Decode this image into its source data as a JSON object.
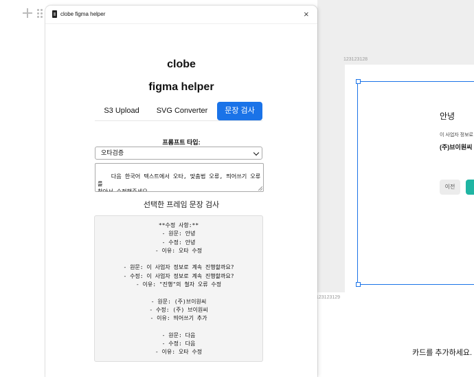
{
  "plugin": {
    "window_title": "clobe figma helper",
    "heading_line1": "clobe",
    "heading_line2": "figma helper",
    "tabs": [
      "S3 Upload",
      "SVG Converter",
      "문장 검사"
    ],
    "active_tab": "문장 검사",
    "prompt_type_label": "프롬프트 타입:",
    "prompt_type_value": "오타검증",
    "prompt_text": "다음 한국어 텍스트에서 오타, 맞춤법 오류, 띄어쓰기 오류를\n찾아서 수정해주세요.\n\n**검증 기준:**",
    "section_title": "선택한 프레임 문장 검사",
    "result_lines": [
      "**수정 사항:**",
      "- 원문: 안녕",
      "- 수정: 안녕",
      "- 이유: 오타 수정",
      "",
      "- 원문: 이 사업자 정보로 계속 진행할까요?",
      "- 수정: 이 사업자 정보로 계속 진행할까요?",
      "- 이유: \"진행\"의 철자 오류 수정",
      "",
      "- 원문: (주)브이원씨",
      "- 수정: (주) 브이원씨",
      "- 이유: 띄어쓰기 추가",
      "",
      "- 원문: 다음",
      "- 수정: 다음",
      "- 이유: 오타 수정"
    ],
    "accent_color": "#1a73e8"
  },
  "canvas": {
    "frame_label_top": "123123128",
    "frame_label_bottom": "123123129",
    "card_title": "안녕",
    "card_subtitle": "이 사업자 정보로",
    "card_company": "(주)브이원씨",
    "prev_button": "이전",
    "add_card_text": "카드를 추가하세요.",
    "next_button_color": "#1fb5a3"
  }
}
